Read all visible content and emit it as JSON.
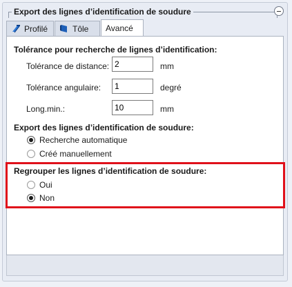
{
  "group": {
    "title": "Export des lignes d’identification de soudure"
  },
  "tabs": [
    {
      "label": "Profilé",
      "icon": "profile-icon"
    },
    {
      "label": "Tôle",
      "icon": "sheet-metal-icon"
    },
    {
      "label": "Avancé",
      "icon": ""
    }
  ],
  "tolerance": {
    "title": "Tolérance pour recherche de lignes d’identification:",
    "rows": [
      {
        "label": "Tolérance de distance:",
        "value": "2",
        "unit": "mm"
      },
      {
        "label": "Tolérance angulaire:",
        "value": "1",
        "unit": "degré"
      },
      {
        "label": "Long.min.:",
        "value": "10",
        "unit": "mm"
      }
    ]
  },
  "export": {
    "title": "Export des lignes d’identification de soudure:",
    "options": [
      {
        "label": "Recherche automatique",
        "checked": true
      },
      {
        "label": "Créé manuellement",
        "checked": false
      }
    ]
  },
  "group_lines": {
    "title": "Regrouper les lignes d’identification de soudure:",
    "options": [
      {
        "label": "Oui",
        "checked": false
      },
      {
        "label": "Non",
        "checked": true
      }
    ]
  },
  "colors": {
    "highlight": "#e0101a",
    "accent": "#1e6fd0"
  }
}
